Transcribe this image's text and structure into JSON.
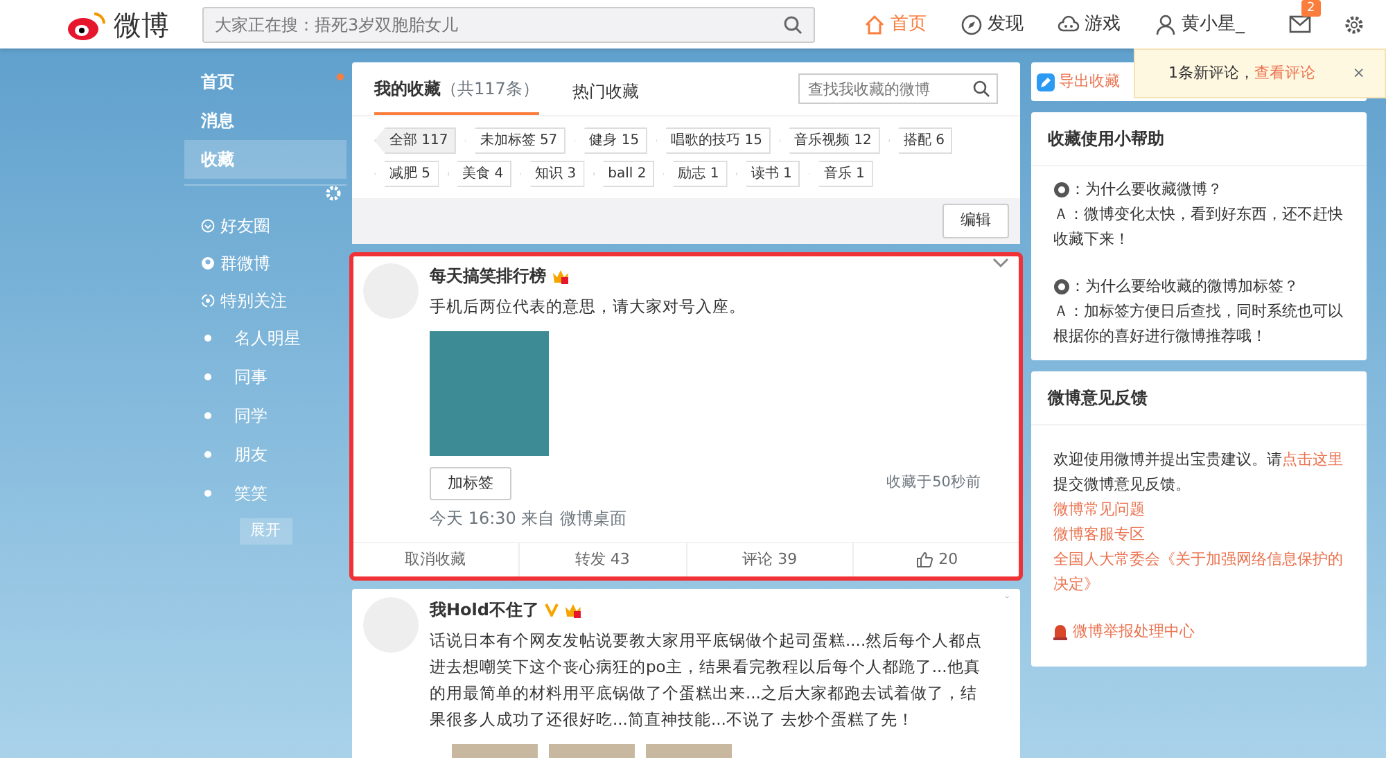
{
  "top_nav": {
    "logo_text": "微博",
    "search": {
      "placeholder": "大家正在搜：捂死3岁双胞胎女儿"
    },
    "items": [
      {
        "label": "首页",
        "kind": "home",
        "selected": true
      },
      {
        "label": "发现",
        "kind": "discover",
        "selected": false
      },
      {
        "label": "游戏",
        "kind": "game",
        "selected": false
      },
      {
        "label": "黄小星_",
        "kind": "user",
        "selected": false
      }
    ],
    "message_badge": "2"
  },
  "notification": {
    "text": "1条新评论，",
    "link": "查看评论",
    "close": "×"
  },
  "sidebar": {
    "items": [
      {
        "label": "首页",
        "kind": "main",
        "selected": false,
        "unread": true
      },
      {
        "label": "消息",
        "kind": "main",
        "selected": false,
        "unread": false
      },
      {
        "label": "收藏",
        "kind": "main",
        "selected": true,
        "unread": false
      },
      {
        "label": "好友圈",
        "kind": "circle",
        "selected": false,
        "unread": false
      },
      {
        "label": "群微博",
        "kind": "group",
        "selected": false,
        "unread": false
      },
      {
        "label": "特别关注",
        "kind": "special",
        "selected": false,
        "unread": false
      },
      {
        "label": "名人明星",
        "kind": "list",
        "selected": false,
        "unread": false
      },
      {
        "label": "同事",
        "kind": "list",
        "selected": false,
        "unread": false
      },
      {
        "label": "同学",
        "kind": "list",
        "selected": false,
        "unread": false
      },
      {
        "label": "朋友",
        "kind": "list",
        "selected": false,
        "unread": false
      },
      {
        "label": "笑笑",
        "kind": "list",
        "selected": false,
        "unread": false
      }
    ],
    "expand": "展开"
  },
  "favorites": {
    "tabs": [
      {
        "label": "我的收藏",
        "count": "（共117条）",
        "selected": true
      },
      {
        "label": "热门收藏",
        "selected": false
      }
    ],
    "search": {
      "placeholder": "查找我收藏的微博"
    },
    "tags": [
      {
        "label": "全部 117",
        "selected": true
      },
      {
        "label": "未加标签 57",
        "selected": false
      },
      {
        "label": "健身 15",
        "selected": false
      },
      {
        "label": "唱歌的技巧 15",
        "selected": false
      },
      {
        "label": "音乐视频 12",
        "selected": false
      },
      {
        "label": "搭配 6",
        "selected": false
      },
      {
        "label": "减肥 5",
        "selected": false
      },
      {
        "label": "美食 4",
        "selected": false
      },
      {
        "label": "知识 3",
        "selected": false
      },
      {
        "label": "ball 2",
        "selected": false
      },
      {
        "label": "励志 1",
        "selected": false
      },
      {
        "label": "读书 1",
        "selected": false
      },
      {
        "label": "音乐 1",
        "selected": false
      }
    ],
    "edit_button": "编辑"
  },
  "posts": [
    {
      "author": "每天搞笑排行榜",
      "verified": false,
      "highlighted": true,
      "text": "手机后两位代表的意思，请大家对号入座。",
      "kind": "single_image",
      "tag_button": "加标签",
      "saved_time": "收藏于50秒前",
      "meta": "今天 16:30 来自 微博桌面",
      "actions": [
        {
          "label": "取消收藏",
          "kind": "text"
        },
        {
          "label": "转发 43",
          "kind": "text"
        },
        {
          "label": "评论 39",
          "kind": "text"
        },
        {
          "label": "20",
          "kind": "like"
        }
      ]
    },
    {
      "author": "我Hold不住了",
      "verified": true,
      "highlighted": false,
      "text": "话说日本有个网友发帖说要教大家用平底锅做个起司蛋糕....然后每个人都点进去想嘲笑下这个丧心病狂的po主，结果看完教程以后每个人都跪了...他真的用最简单的材料用平底锅做了个蛋糕出来...之后大家都跑去试着做了，结果很多人成功了还很好吃...简直神技能...不说了 去炒个蛋糕了先！",
      "kind": "photo_row"
    }
  ],
  "right": {
    "export_link": "导出收藏",
    "help": {
      "title": "收藏使用小帮助",
      "qa": [
        {
          "q": "：为什么要收藏微博？",
          "a": "Ａ：微博变化太快，看到好东西，还不赶快收藏下来！"
        },
        {
          "q": "：为什么要给收藏的微博加标签？",
          "a": "Ａ：加标签方便日后查找，同时系统也可以根据你的喜好进行微博推荐哦！"
        }
      ]
    },
    "feedback": {
      "title": "微博意见反馈",
      "intro": "欢迎使用微博并提出宝贵建议。请",
      "intro_link": "点击这里",
      "intro_after": "提交微博意见反馈。",
      "links": [
        "微博常见问题",
        "微博客服专区",
        "全国人大常委会《关于加强网络信息保护的决定》"
      ],
      "report": "微博举报处理中心"
    }
  }
}
